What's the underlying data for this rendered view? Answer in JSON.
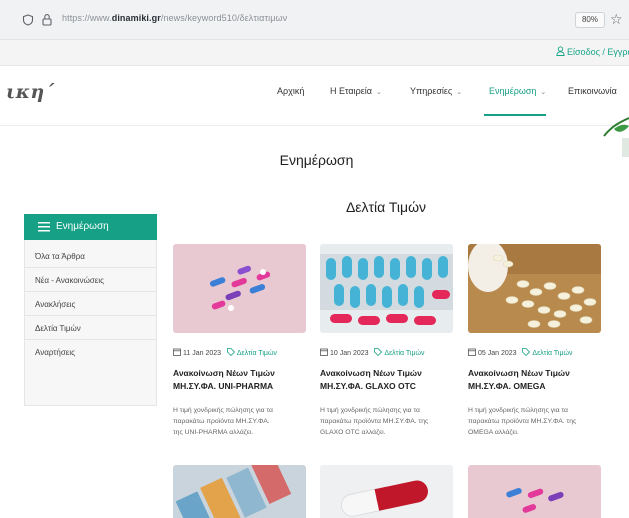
{
  "browser": {
    "url_prefix": "https://www.",
    "url_domain": "dinamiki.gr",
    "url_path": "/news/keyword510/δελτιατιμων",
    "zoom": "80%"
  },
  "topbar": {
    "login_label": "Είσοδος / Εγγραφ"
  },
  "header": {
    "logo_text": "ικη΄"
  },
  "nav": {
    "items": [
      {
        "label": "Αρχική"
      },
      {
        "label": "Η Εταιρεία"
      },
      {
        "label": "Υπηρεσίες"
      },
      {
        "label": "Ενημέρωση"
      },
      {
        "label": "Επικοινωνία"
      }
    ]
  },
  "page": {
    "title": "Ενημέρωση",
    "section_title": "Δελτία Τιμών"
  },
  "sidebar": {
    "title": "Ενημέρωση",
    "items": [
      {
        "label": "Όλα τα Άρθρα"
      },
      {
        "label": "Νέα - Ανακοινώσεις"
      },
      {
        "label": "Ανακλήσεις"
      },
      {
        "label": "Δελτία Τιμών"
      },
      {
        "label": "Αναρτήσεις"
      }
    ]
  },
  "cards": [
    {
      "date": "11 Jan 2023",
      "tag": "Δελτία Τιμών",
      "title_line1": "Ανακοίνωση Νέων Τιμών",
      "title_line2": "ΜΗ.ΣΥ.ΦΑ. UNI-PHARMA",
      "desc_line1": "Η τιμή χονδρικής πώλησης για τα",
      "desc_line2": "παρακάτω προϊόντα  ΜΗ.ΣΥ.ΦΑ.",
      "desc_line3": "της UNI-PHARMA αλλάζει."
    },
    {
      "date": "10 Jan 2023",
      "tag": "Δελτία Τιμών",
      "title_line1": "Ανακοίνωση Νέων Τιμών",
      "title_line2": "ΜΗ.ΣΥ.ΦΑ. GLAXO OTC",
      "desc_line1": "Η τιμή χονδρικής πώλησης για τα",
      "desc_line2": "παρακάτω προϊόντα  ΜΗ.ΣΥ.ΦΑ. της",
      "desc_line3": "GLAXO OTC αλλάζει."
    },
    {
      "date": "05 Jan 2023",
      "tag": "Δελτία Τιμών",
      "title_line1": "Ανακοίνωση Νέων Τιμών",
      "title_line2": "ΜΗ.ΣΥ.ΦΑ. OMEGA",
      "desc_line1": "Η τιμή χονδρικής πώλησης για τα",
      "desc_line2": "παρακάτω προϊόντα  ΜΗ.ΣΥ.ΦΑ. της",
      "desc_line3": "OMEGA αλλάζει."
    }
  ],
  "colors": {
    "accent": "#16a085",
    "sidebar_bg": "#f7f7f7"
  }
}
